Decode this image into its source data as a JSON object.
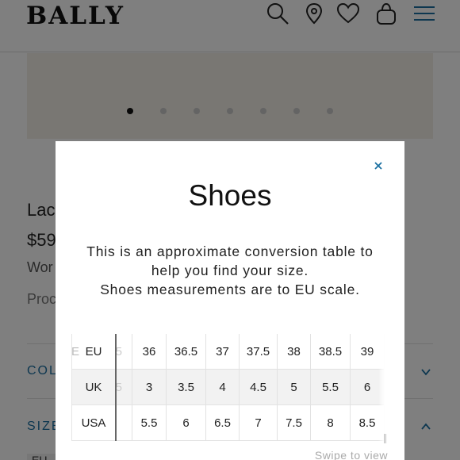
{
  "header": {
    "logo": "BALLY",
    "icons": [
      "search-icon",
      "location-icon",
      "heart-icon",
      "bag-icon",
      "menu-icon"
    ]
  },
  "gallery": {
    "slide_count": 7,
    "active_index": 0
  },
  "product": {
    "title_partial": "Lac",
    "price_partial": "$59",
    "subtitle_partial": "Wor",
    "code_partial": "Proc"
  },
  "accordion": {
    "color_label_partial": "COL",
    "size_label_partial": "SIZE",
    "size_chip": "EU"
  },
  "modal": {
    "title": "Shoes",
    "description_lines": [
      "This is an approximate conversion table to",
      "help you find your size.",
      "Shoes measurements are to EU scale."
    ],
    "swipe_hint": "Swipe to view",
    "table": {
      "row_labels": [
        "EU",
        "UK",
        "USA"
      ],
      "edge_ghost": [
        "E",
        "",
        ""
      ],
      "ghost_column": [
        "5",
        "5",
        ""
      ],
      "rows": [
        [
          "36",
          "36.5",
          "37",
          "37.5",
          "38",
          "38.5",
          "39"
        ],
        [
          "3",
          "3.5",
          "4",
          "4.5",
          "5",
          "5.5",
          "6"
        ],
        [
          "5.5",
          "6",
          "6.5",
          "7",
          "7.5",
          "8",
          "8.5"
        ]
      ]
    }
  },
  "colors": {
    "accent": "#1a6fa0",
    "scrim": "rgba(0,0,0,0.5)"
  }
}
